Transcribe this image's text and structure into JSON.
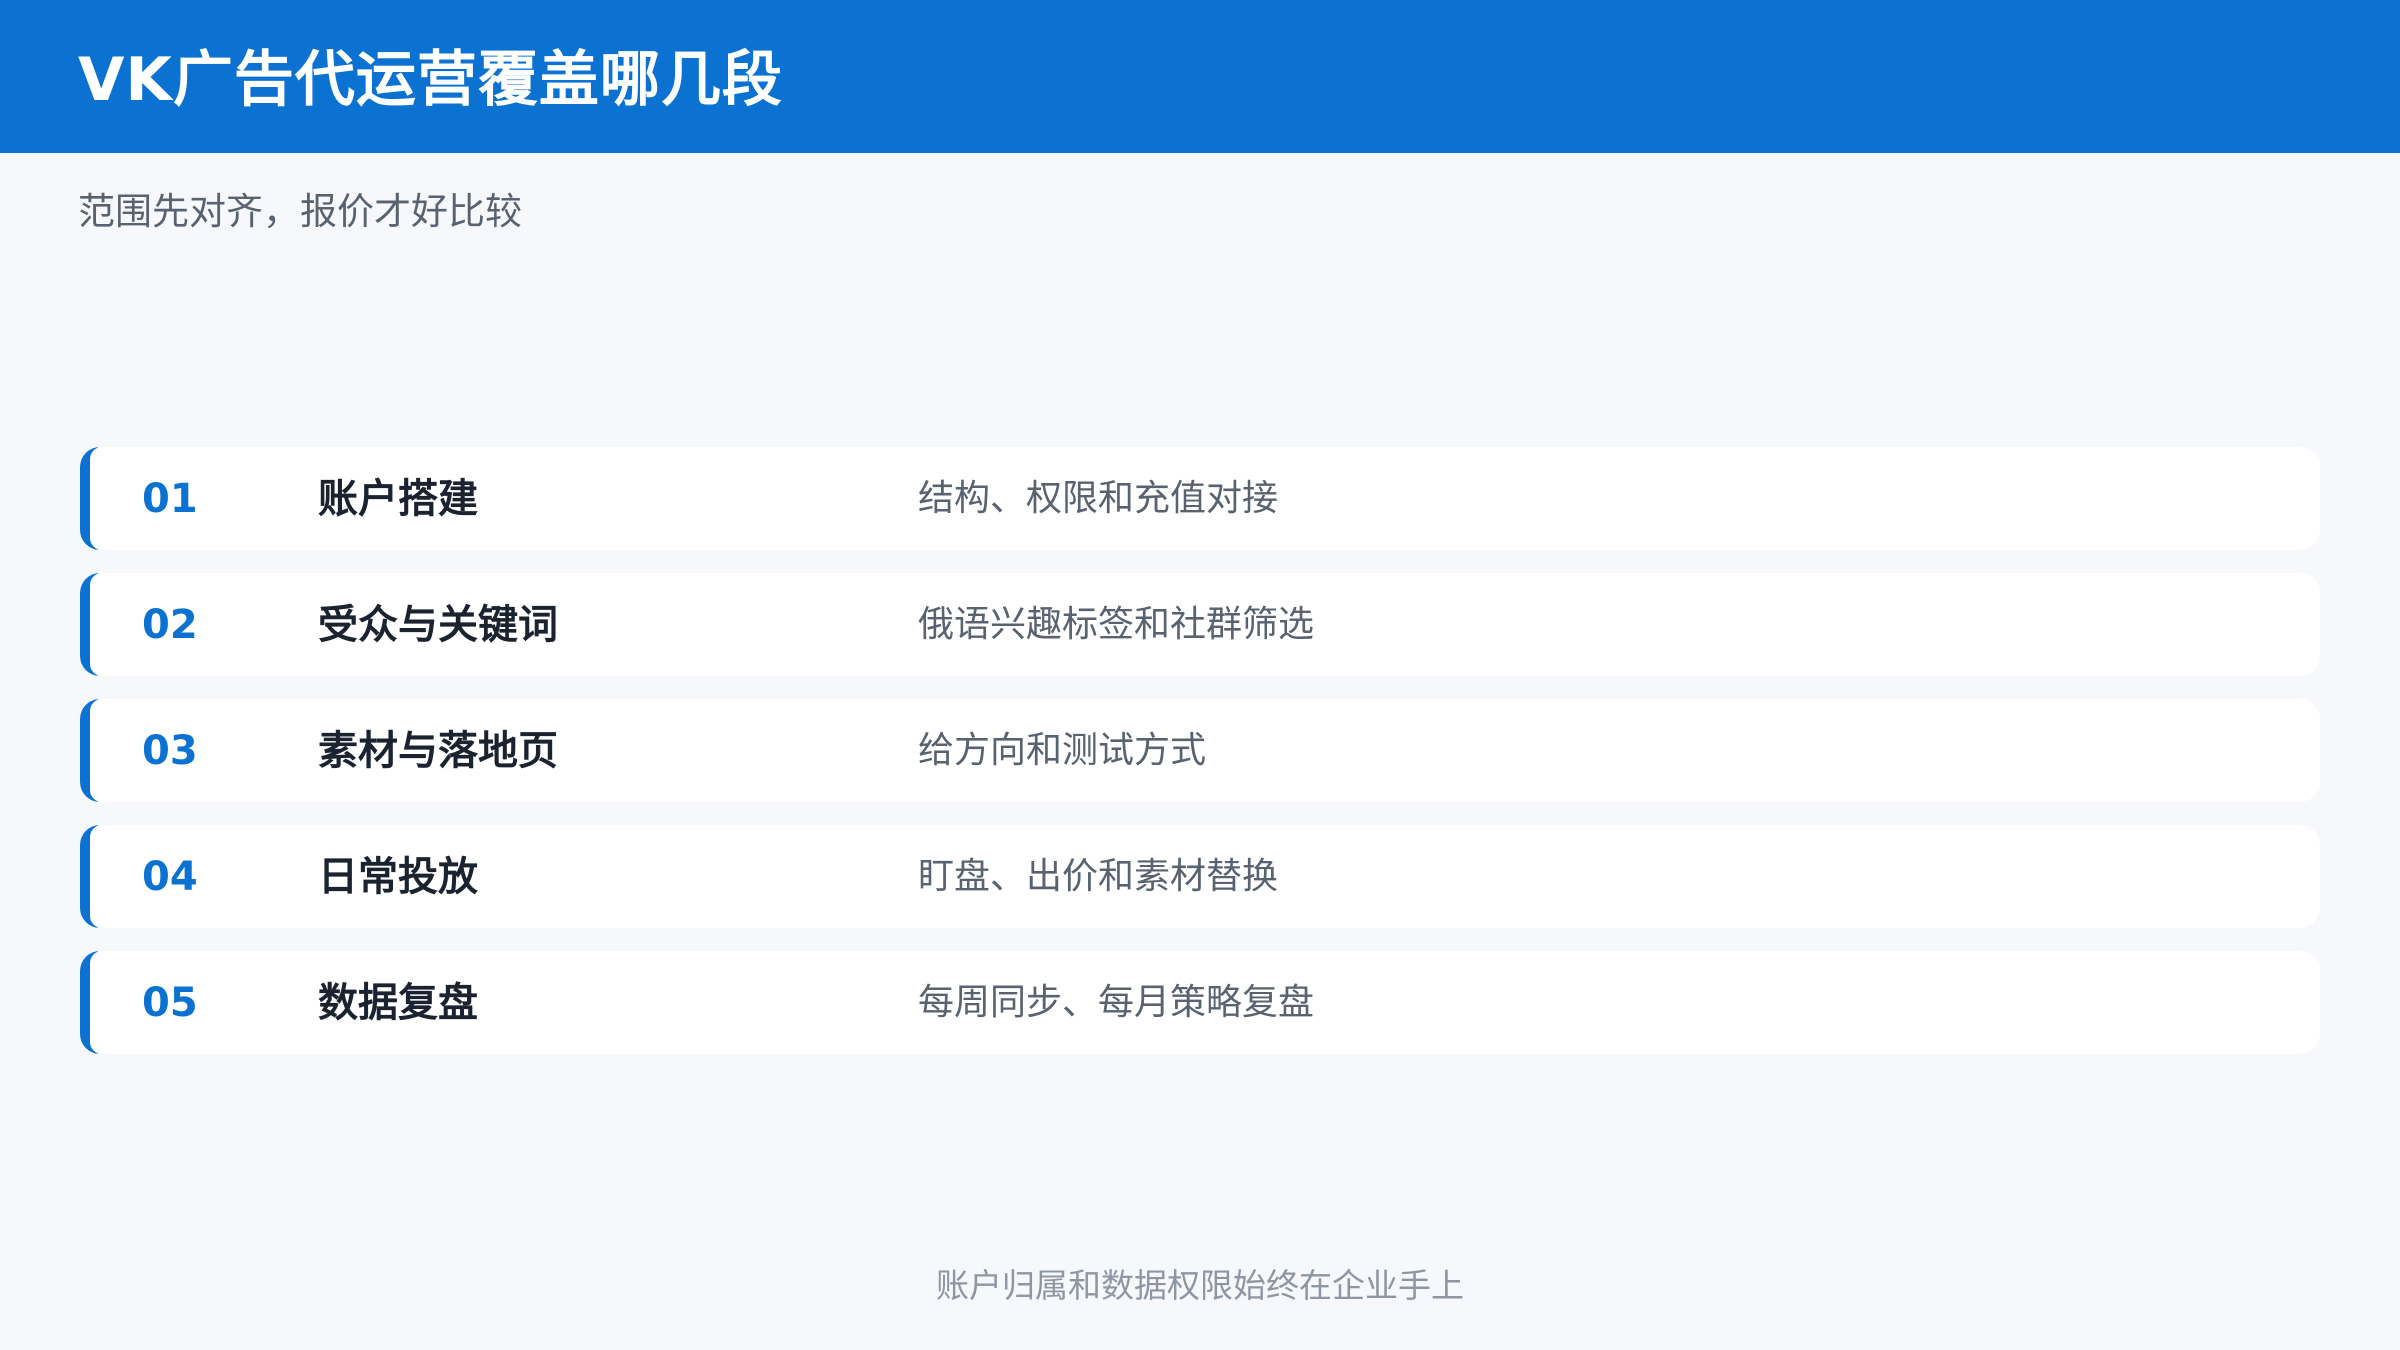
{
  "header": {
    "title": "VK广告代运营覆盖哪几段",
    "subtitle": "范围先对齐，报价才好比较"
  },
  "rows": [
    {
      "number": "01",
      "title": "账户搭建",
      "description": "结构、权限和充值对接"
    },
    {
      "number": "02",
      "title": "受众与关键词",
      "description": "俄语兴趣标签和社群筛选"
    },
    {
      "number": "03",
      "title": "素材与落地页",
      "description": "给方向和测试方式"
    },
    {
      "number": "04",
      "title": "日常投放",
      "description": "盯盘、出价和素材替换"
    },
    {
      "number": "05",
      "title": "数据复盘",
      "description": "每周同步、每月策略复盘"
    }
  ],
  "footer": {
    "note": "账户归属和数据权限始终在企业手上"
  },
  "colors": {
    "primary": "#0b72d1",
    "background": "#f6f8fc",
    "card": "#ffffff",
    "title_text": "#1b2330",
    "body_text": "#596270",
    "muted_text": "#8f96a3"
  }
}
